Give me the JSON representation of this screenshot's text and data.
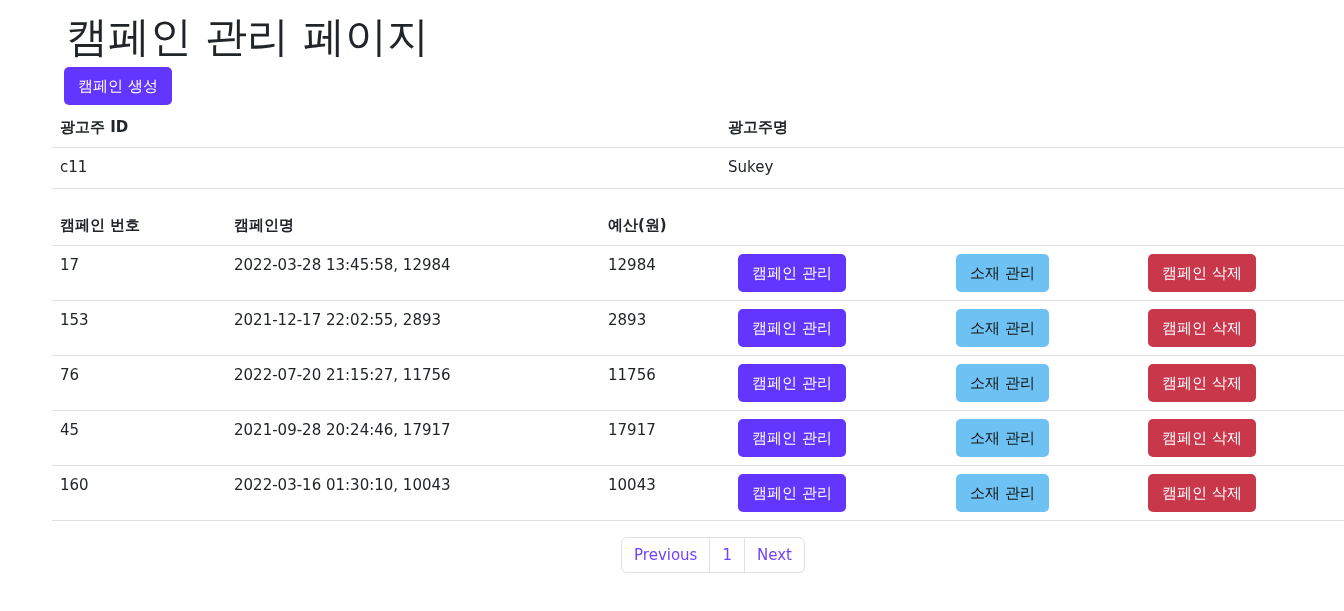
{
  "page_title": "캠페인 관리 페이지",
  "create_button": "캠페인 생성",
  "advertiser_table": {
    "columns": [
      "광고주 ID",
      "광고주명"
    ],
    "rows": [
      [
        "c11",
        "Sukey"
      ]
    ]
  },
  "campaign_table": {
    "columns": [
      "캠페인 번호",
      "캠페인명",
      "예산(원)"
    ],
    "rows": [
      {
        "number": "17",
        "name": "2022-03-28 13:45:58, 12984",
        "budget": "12984",
        "actions": [
          {
            "label": "캠페인 관리",
            "kind": "primary"
          },
          {
            "label": "소재 관리",
            "kind": "info"
          },
          {
            "label": "캠페인 삭제",
            "kind": "danger"
          }
        ]
      },
      {
        "number": "153",
        "name": "2021-12-17 22:02:55, 2893",
        "budget": "2893",
        "actions": [
          {
            "label": "캠페인 관리",
            "kind": "primary"
          },
          {
            "label": "소재 관리",
            "kind": "info"
          },
          {
            "label": "캠페인 삭제",
            "kind": "danger"
          }
        ]
      },
      {
        "number": "76",
        "name": "2022-07-20 21:15:27, 11756",
        "budget": "11756",
        "actions": [
          {
            "label": "캠페인 관리",
            "kind": "primary"
          },
          {
            "label": "소재 관리",
            "kind": "info"
          },
          {
            "label": "캠페인 삭제",
            "kind": "danger"
          }
        ]
      },
      {
        "number": "45",
        "name": "2021-09-28 20:24:46, 17917",
        "budget": "17917",
        "actions": [
          {
            "label": "캠페인 관리",
            "kind": "primary"
          },
          {
            "label": "소재 관리",
            "kind": "info"
          },
          {
            "label": "캠페인 삭제",
            "kind": "danger"
          }
        ]
      },
      {
        "number": "160",
        "name": "2022-03-16 01:30:10, 10043",
        "budget": "10043",
        "actions": [
          {
            "label": "캠페인 관리",
            "kind": "primary"
          },
          {
            "label": "소재 관리",
            "kind": "info"
          },
          {
            "label": "캠페인 삭제",
            "kind": "danger"
          }
        ]
      }
    ]
  },
  "pagination": [
    "Previous",
    "1",
    "Next"
  ]
}
